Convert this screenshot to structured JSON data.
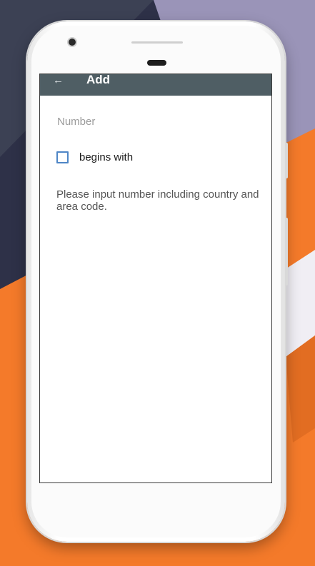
{
  "app_bar": {
    "back_icon": "←",
    "title": "Add"
  },
  "form": {
    "number_placeholder": "Number",
    "begins_with_label": "begins with",
    "begins_with_checked": false,
    "hint": "Please input number including country and area code."
  },
  "colors": {
    "app_bar": "#4f5e64",
    "checkbox_border": "#4f86c6",
    "background_orange": "#f47a2a",
    "background_navy": "#2e3148",
    "background_lavender": "#9a94b8"
  }
}
